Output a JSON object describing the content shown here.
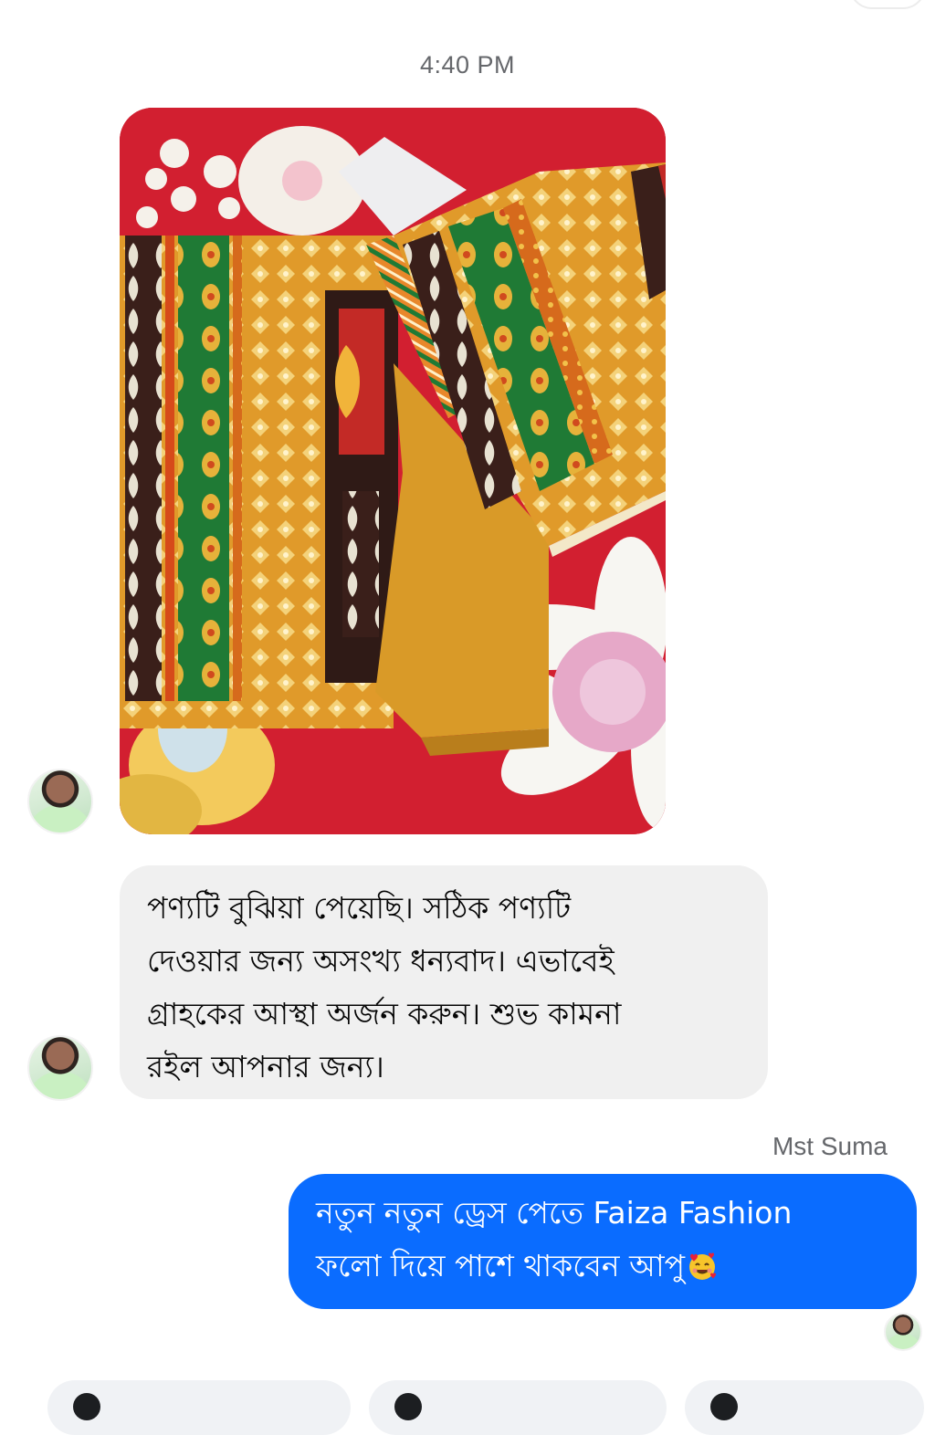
{
  "conversation": {
    "timestamp": "4:40 PM",
    "incoming_message": {
      "lines": [
        "পণ্যটি বুঝিয়া পেয়েছি। সঠিক পণ্যটি",
        "দেওয়ার জন্য অসংখ্য ধন্যবাদ। এভাবেই",
        "গ্রাহকের আস্থা অর্জন করুন। শুভ কামনা",
        "রইল আপনার জন্য।"
      ]
    },
    "reply_sender": "Mst Suma",
    "outgoing_message": {
      "lines": [
        "নতুন নতুন ড্রেস পেতে Faiza Fashion",
        "ফলো দিয়ে পাশে থাকবেন আপু"
      ],
      "emoji": "smiling-face-with-hearts"
    }
  },
  "colors": {
    "outgoing_bubble": "#0a6cff",
    "incoming_bubble": "#f0f0f0",
    "timestamp_text": "#65676b"
  }
}
